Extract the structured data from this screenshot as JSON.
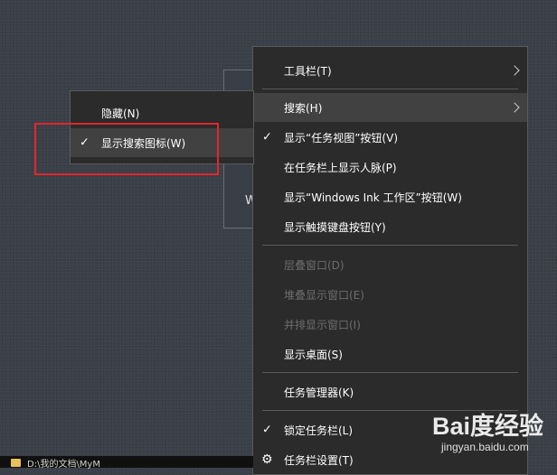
{
  "background_panel": {
    "text": "W"
  },
  "main_menu": {
    "items": [
      {
        "label": "工具栏(T)",
        "arrow": true
      },
      {
        "label": "搜索(H)",
        "arrow": true,
        "highlighted": true
      },
      {
        "label": "显示“任务视图”按钮(V)",
        "checked": true
      },
      {
        "label": "在任务栏上显示人脉(P)"
      },
      {
        "label": "显示“Windows Ink 工作区”按钮(W)"
      },
      {
        "label": "显示触摸键盘按钮(Y)"
      },
      {
        "label": "层叠窗口(D)",
        "disabled": true
      },
      {
        "label": "堆叠显示窗口(E)",
        "disabled": true
      },
      {
        "label": "并排显示窗口(I)",
        "disabled": true
      },
      {
        "label": "显示桌面(S)"
      },
      {
        "label": "任务管理器(K)"
      },
      {
        "label": "锁定任务栏(L)",
        "checked": true
      },
      {
        "label": "任务栏设置(T)",
        "icon": "gear-icon"
      }
    ]
  },
  "sub_menu": {
    "items": [
      {
        "label": "隐藏(N)"
      },
      {
        "label": "显示搜索图标(W)",
        "checked": true,
        "highlighted": true
      }
    ]
  },
  "check_glyph": "✓",
  "gear_glyph": "⚙",
  "taskbar": {
    "text": "D:\\我的文档\\MyM"
  },
  "watermark": {
    "logo": "Bai度经验",
    "url": "jingyan.baidu.com"
  },
  "colors": {
    "menu_bg": "#2b2b2b",
    "hover_bg": "#414141",
    "highlight_box": "#e2262b",
    "disabled_text": "#6d6d6d"
  }
}
